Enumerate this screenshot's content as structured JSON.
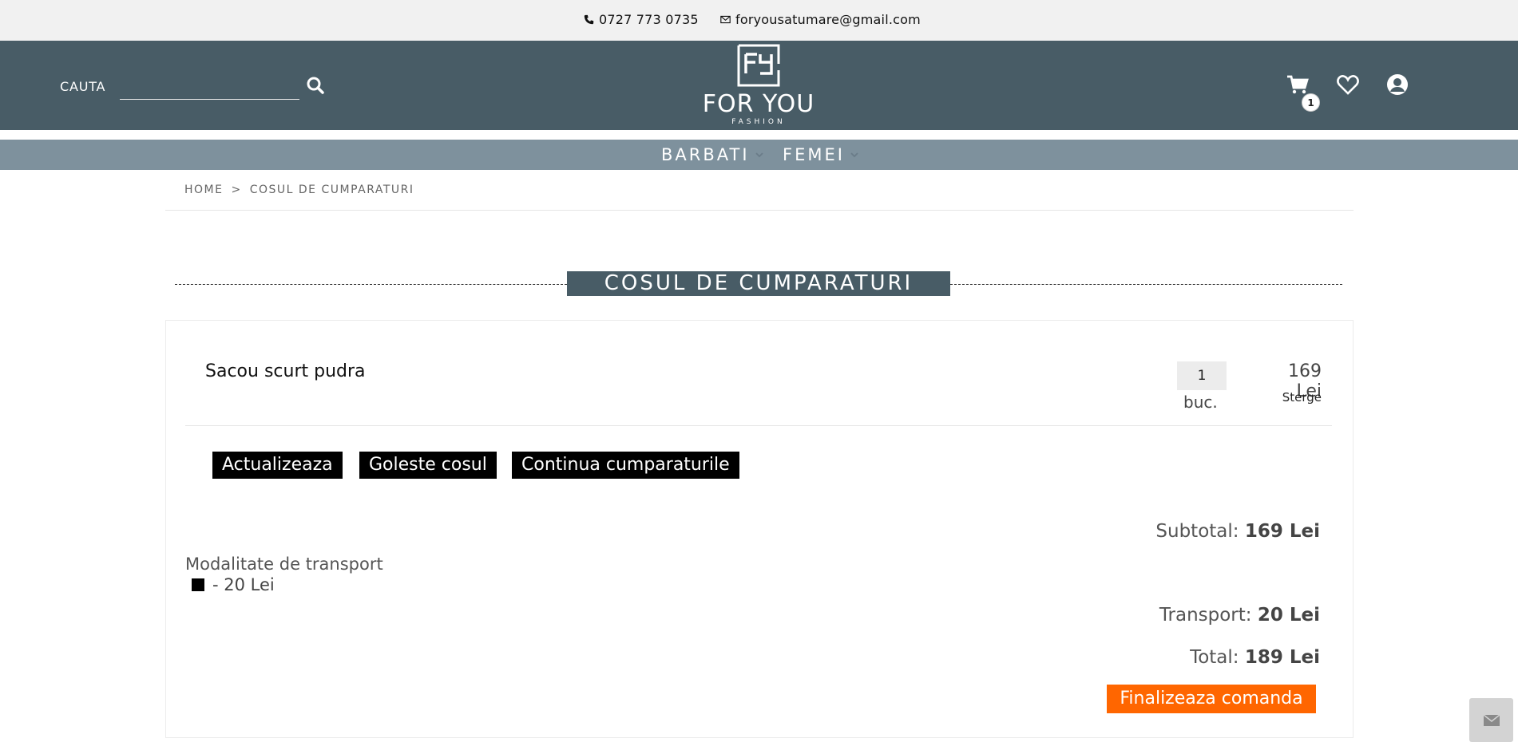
{
  "topbar": {
    "phone": "0727 773 0735",
    "email": "foryousatumare@gmail.com"
  },
  "header": {
    "search_label": "CAUTA",
    "search_placeholder": "",
    "logo_brand": "FOR YOU",
    "logo_tagline": "FASHION",
    "cart_count": "1"
  },
  "nav": {
    "items": [
      {
        "label": "BARBATI"
      },
      {
        "label": "FEMEI"
      }
    ]
  },
  "breadcrumb": {
    "home": "HOME",
    "separator": ">",
    "current": "COSUL DE CUMPARATURI"
  },
  "page_title": "COSUL DE CUMPARATURI",
  "cart": {
    "items": [
      {
        "name": "Sacou scurt pudra",
        "quantity": "1",
        "unit": "buc.",
        "price": "169 Lei",
        "remove_label": "Sterge"
      }
    ],
    "actions": {
      "update": "Actualizeaza",
      "empty": "Goleste cosul",
      "continue": "Continua cumparaturile"
    },
    "transport": {
      "title": "Modalitate de transport",
      "option": "- 20 Lei"
    },
    "summary": {
      "subtotal_label": "Subtotal:",
      "subtotal_value": "169 Lei",
      "transport_label": "Transport:",
      "transport_value": "20 Lei",
      "total_label": "Total:",
      "total_value": "189 Lei"
    },
    "checkout_label": "Finalizeaza comanda"
  },
  "colors": {
    "header_bg": "#485c66",
    "nav_bg": "#7e919d",
    "checkout": "#ff6600"
  },
  "icons": [
    "phone-icon",
    "envelope-icon",
    "search-icon",
    "cart-icon",
    "heart-icon",
    "user-icon",
    "chevron-down-icon",
    "message-icon"
  ]
}
